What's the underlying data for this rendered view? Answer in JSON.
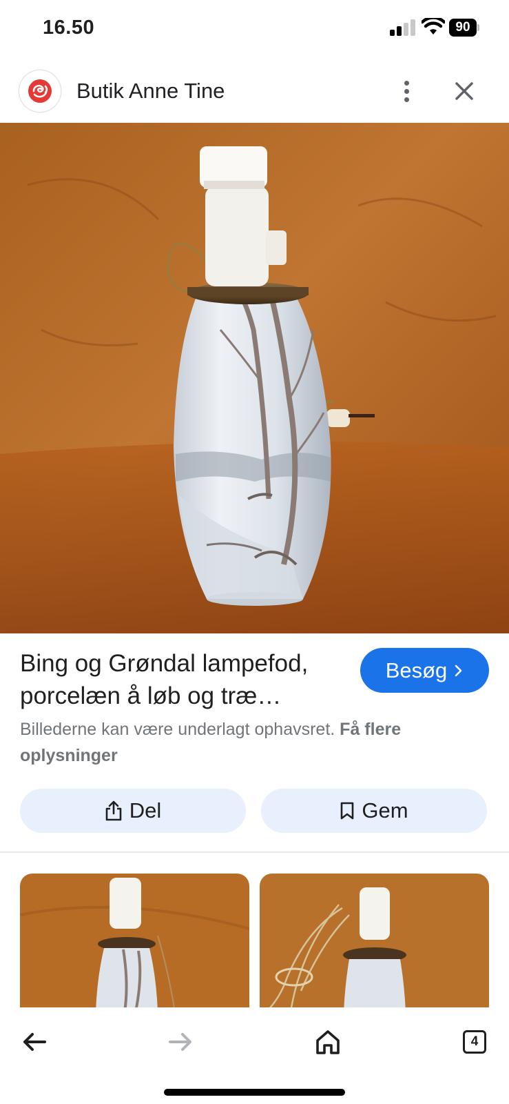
{
  "status_bar": {
    "time": "16.50",
    "battery": "90"
  },
  "header": {
    "site_name": "Butik Anne Tine",
    "logo_icon": "rose-logo-icon",
    "brand_color": "#d93025"
  },
  "result": {
    "title": "Bing og Grøndal lampefod, porcelæn å løb og træ…",
    "visit_label": "Besøg",
    "copyright_text": "Billederne kan være underlagt ophavsret.",
    "more_info_link": "Få flere oplysninger"
  },
  "actions": {
    "share_label": "Del",
    "save_label": "Gem"
  },
  "bottom_nav": {
    "tab_count": "4"
  },
  "colors": {
    "accent": "#1a73e8",
    "chip_bg": "#e8f0fe",
    "hero_bg": "#b8692a"
  }
}
